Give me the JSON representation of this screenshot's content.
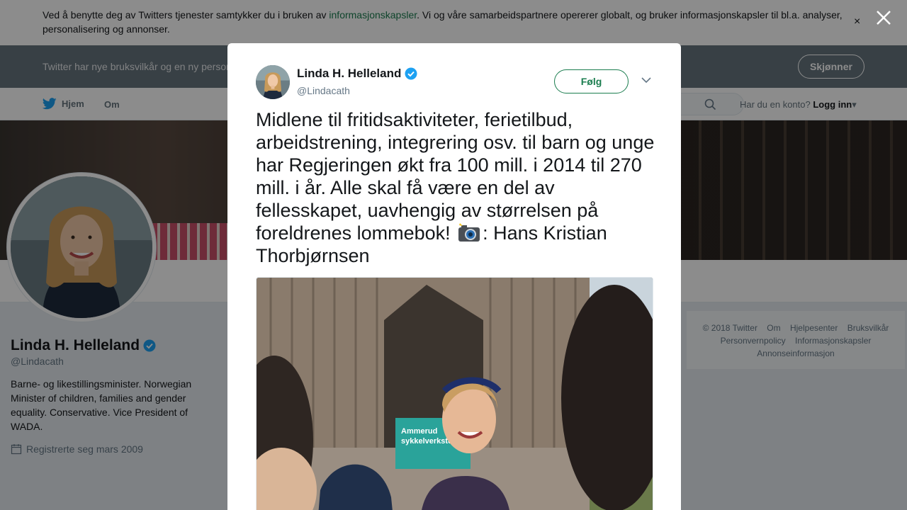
{
  "cookie_banner": {
    "text_before": "Ved å benytte deg av Twitters tjenester samtykker du i bruken av ",
    "link": "informasjonskapsler",
    "text_after": ". Vi og våre samarbeidspartnere opererer globalt, og bruker informasjonskapsler til bl.a. analyser, personalisering og annonser.",
    "close_label": "×"
  },
  "terms_bar": {
    "text": "Twitter har nye bruksvilkår og en ny personvernpolicy",
    "button": "Skjønner"
  },
  "nav": {
    "home": "Hjem",
    "about": "Om",
    "login_prompt": "Har du en konto?",
    "login": "Logg inn"
  },
  "profile": {
    "name": "Linda H. Helleland",
    "handle": "@Lindacath",
    "bio": "Barne- og likestillingsminister. Norwegian Minister of children, families and gender equality. Conservative. Vice President of WADA.",
    "joined": "Registrerte seg mars 2009"
  },
  "footer": {
    "links": [
      "© 2018 Twitter",
      "Om",
      "Hjelpesenter",
      "Bruksvilkår",
      "Personvernpolicy",
      "Informasjonskapsler",
      "Annonseinformasjon"
    ]
  },
  "tweet": {
    "name": "Linda H. Helleland",
    "handle": "@Lindacath",
    "follow": "Følg",
    "text_before_emoji": "Midlene til fritidsaktiviteter, ferietilbud, arbeidstrening, integrering osv. til barn og unge har Regjeringen økt fra 100 mill. i 2014 til 270 mill. i år. Alle skal få være en del av fellesskapet, uavhengig av størrelsen på foreldrenes lommebok! ",
    "text_after_emoji": ": Hans Kristian Thorbjørnsen",
    "photo_sign": "Ammerud sykkelverksted"
  },
  "colors": {
    "link_green": "#1b7d4f",
    "verified_blue": "#1da1f2",
    "twitter_blue": "#1da1f2"
  }
}
